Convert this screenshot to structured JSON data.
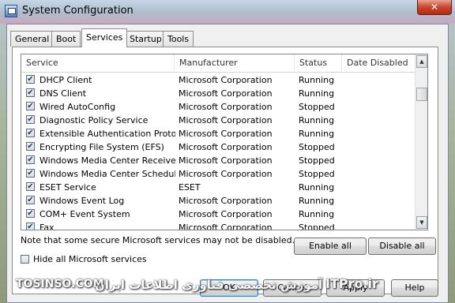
{
  "window": {
    "title": "System Configuration",
    "close_glyph": "✕"
  },
  "tabs": [
    {
      "label": "General"
    },
    {
      "label": "Boot"
    },
    {
      "label": "Services",
      "active": true
    },
    {
      "label": "Startup"
    },
    {
      "label": "Tools"
    }
  ],
  "services": {
    "columns": {
      "service": "Service",
      "manufacturer": "Manufacturer",
      "status": "Status",
      "date_disabled": "Date Disabled"
    },
    "rows": [
      {
        "name": "DHCP Client",
        "manufacturer": "Microsoft Corporation",
        "status": "Running",
        "checked": true
      },
      {
        "name": "DNS Client",
        "manufacturer": "Microsoft Corporation",
        "status": "Running",
        "checked": true
      },
      {
        "name": "Wired AutoConfig",
        "manufacturer": "Microsoft Corporation",
        "status": "Stopped",
        "checked": true
      },
      {
        "name": "Diagnostic Policy Service",
        "manufacturer": "Microsoft Corporation",
        "status": "Running",
        "checked": true
      },
      {
        "name": "Extensible Authentication Protocol",
        "manufacturer": "Microsoft Corporation",
        "status": "Running",
        "checked": true
      },
      {
        "name": "Encrypting File System (EFS)",
        "manufacturer": "Microsoft Corporation",
        "status": "Stopped",
        "checked": true
      },
      {
        "name": "Windows Media Center Receiver...",
        "manufacturer": "Microsoft Corporation",
        "status": "Stopped",
        "checked": true
      },
      {
        "name": "Windows Media Center Schedule...",
        "manufacturer": "Microsoft Corporation",
        "status": "Stopped",
        "checked": true
      },
      {
        "name": "ESET Service",
        "manufacturer": "ESET",
        "status": "Running",
        "checked": true
      },
      {
        "name": "Windows Event Log",
        "manufacturer": "Microsoft Corporation",
        "status": "Running",
        "checked": true
      },
      {
        "name": "COM+ Event System",
        "manufacturer": "Microsoft Corporation",
        "status": "Running",
        "checked": true
      },
      {
        "name": "Fax",
        "manufacturer": "Microsoft Corporation",
        "status": "Stopped",
        "checked": true
      }
    ],
    "check_glyph": "✔",
    "scroll_up_glyph": "▲",
    "scroll_down_glyph": "▼"
  },
  "note": "Note that some secure Microsoft services may not be disabled.",
  "buttons": {
    "enable_all": "Enable all",
    "disable_all": "Disable all",
    "ok": "OK",
    "cancel": "Cancel",
    "apply": "Apply",
    "help": "Help"
  },
  "hide_ms": {
    "label": "Hide all Microsoft services",
    "checked": false
  },
  "watermark": {
    "left": "TOSINSO.COM",
    "middle": "آموزش تخصصی فناوری اطلاعات ایران",
    "right": "ITPro.ir"
  }
}
